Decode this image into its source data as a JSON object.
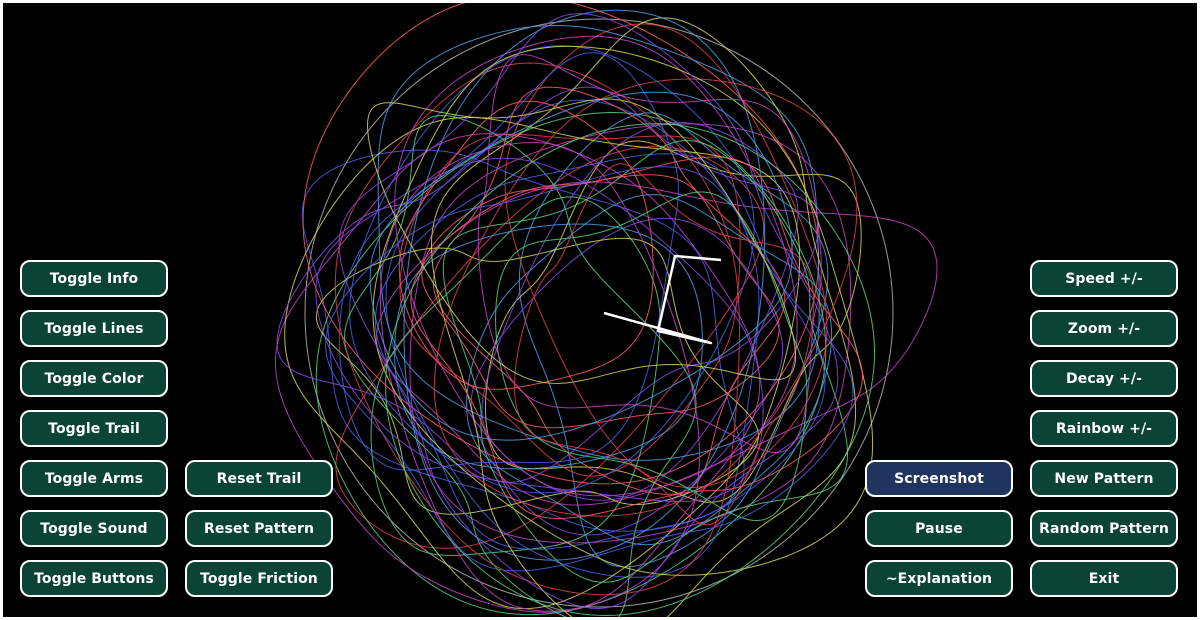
{
  "colors": {
    "background": "#000000",
    "button_fill": "#0b4434",
    "button_active_fill": "#1f345e",
    "button_border": "#ffffff",
    "button_text": "#ffffff",
    "boundary_circle": "#9a9a9a",
    "arms": "#ffffff",
    "trail_palette": [
      "#e0404a",
      "#c842c8",
      "#4a62e6",
      "#4aa0e6",
      "#54d48a",
      "#d8d85a",
      "#ff5a6a",
      "#8a4ae6"
    ]
  },
  "buttons": {
    "toggle_info": {
      "label": "Toggle Info",
      "icon": "none"
    },
    "toggle_lines": {
      "label": "Toggle Lines",
      "icon": "none"
    },
    "toggle_color": {
      "label": "Toggle Color",
      "icon": "none"
    },
    "toggle_trail": {
      "label": "Toggle Trail",
      "icon": "none"
    },
    "toggle_arms": {
      "label": "Toggle Arms",
      "icon": "none"
    },
    "toggle_sound": {
      "label": "Toggle Sound",
      "icon": "none"
    },
    "toggle_buttons": {
      "label": "Toggle Buttons",
      "icon": "none"
    },
    "reset_trail": {
      "label": "Reset Trail",
      "icon": "none"
    },
    "reset_pattern": {
      "label": "Reset Pattern",
      "icon": "none"
    },
    "toggle_friction": {
      "label": "Toggle Friction",
      "icon": "none"
    },
    "screenshot": {
      "label": "Screenshot",
      "icon": "none",
      "state": "highlighted"
    },
    "pause": {
      "label": "Pause",
      "icon": "none"
    },
    "explanation": {
      "label": "~Explanation",
      "icon": "none"
    },
    "speed": {
      "label": "Speed +/-",
      "icon": "none"
    },
    "zoom": {
      "label": "Zoom +/-",
      "icon": "none"
    },
    "decay": {
      "label": "Decay +/-",
      "icon": "none"
    },
    "rainbow": {
      "label": "Rainbow +/-",
      "icon": "none"
    },
    "new_pattern": {
      "label": "New Pattern",
      "icon": "none"
    },
    "random_pattern": {
      "label": "Random Pattern",
      "icon": "none"
    },
    "exit": {
      "label": "Exit",
      "icon": "none"
    }
  }
}
